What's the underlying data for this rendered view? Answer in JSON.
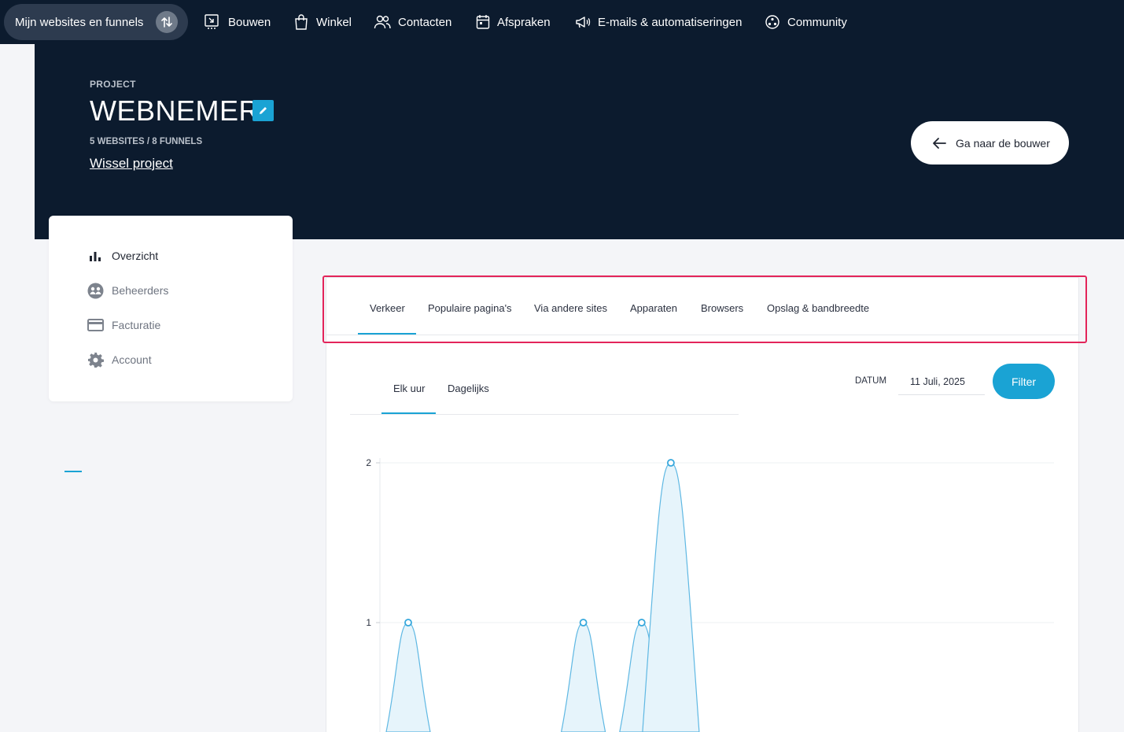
{
  "topnav": {
    "project_switch_label": "Mijn websites en funnels",
    "items": [
      {
        "label": "Bouwen",
        "icon": "builder-icon"
      },
      {
        "label": "Winkel",
        "icon": "shopping-bag-icon"
      },
      {
        "label": "Contacten",
        "icon": "contacts-icon"
      },
      {
        "label": "Afspraken",
        "icon": "calendar-icon"
      },
      {
        "label": "E-mails & automatiseringen",
        "icon": "megaphone-icon"
      },
      {
        "label": "Community",
        "icon": "community-icon"
      }
    ]
  },
  "hero": {
    "eyebrow": "PROJECT",
    "title": "WEBNEMER",
    "counts": "5 WEBSITES / 8 FUNNELS",
    "switch_link": "Wissel project",
    "builder_button": "Ga naar de bouwer"
  },
  "sidebar": {
    "items": [
      {
        "label": "Overzicht",
        "icon": "bar-chart-icon",
        "active": true
      },
      {
        "label": "Beheerders",
        "icon": "users-icon",
        "active": false
      },
      {
        "label": "Facturatie",
        "icon": "credit-card-icon",
        "active": false
      },
      {
        "label": "Account",
        "icon": "gear-icon",
        "active": false
      }
    ]
  },
  "tabs": {
    "items": [
      "Verkeer",
      "Populaire pagina's",
      "Via andere sites",
      "Apparaten",
      "Browsers",
      "Opslag & bandbreedte"
    ],
    "active": "Verkeer"
  },
  "subtabs": {
    "items": [
      "Elk uur",
      "Dagelijks"
    ],
    "active": "Elk uur"
  },
  "filter": {
    "date_label": "DATUM",
    "date_value": "11 Juli, 2025",
    "button": "Filter"
  },
  "colors": {
    "accent": "#1aa3d4",
    "dark": "#0c1b2e",
    "highlight": "#e3245a"
  },
  "chart_data": {
    "type": "area",
    "y_ticks": [
      "1",
      "2"
    ],
    "ylim": [
      0,
      2
    ],
    "points": [
      {
        "x": 1,
        "y": 1
      },
      {
        "x": 7,
        "y": 1
      },
      {
        "x": 9,
        "y": 1
      },
      {
        "x": 10,
        "y": 2
      }
    ]
  }
}
